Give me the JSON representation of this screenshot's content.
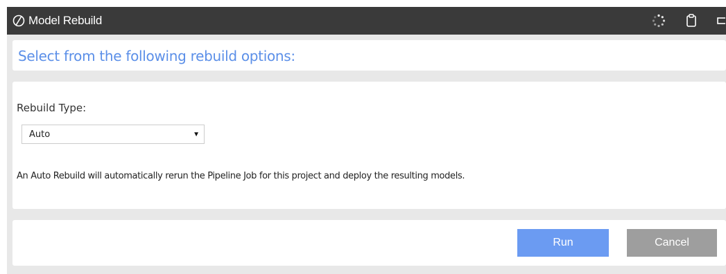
{
  "window": {
    "title": "Model Rebuild",
    "icons": [
      "slash-circle-icon",
      "spinner-icon",
      "clipboard-icon",
      "window-edge-icon"
    ]
  },
  "header": {
    "prompt": "Select from the following rebuild options:"
  },
  "form": {
    "rebuild_type_label": "Rebuild Type:",
    "rebuild_type_value": "Auto",
    "description": "An Auto Rebuild will automatically rerun the Pipeline Job for this project and deploy the resulting models."
  },
  "actions": {
    "run_label": "Run",
    "cancel_label": "Cancel"
  },
  "colors": {
    "titlebar": "#3a3a3a",
    "accent_text": "#5b8fe8",
    "run_button": "#6b9bf2",
    "cancel_button": "#9e9e9e",
    "background": "#e8e8e8"
  }
}
